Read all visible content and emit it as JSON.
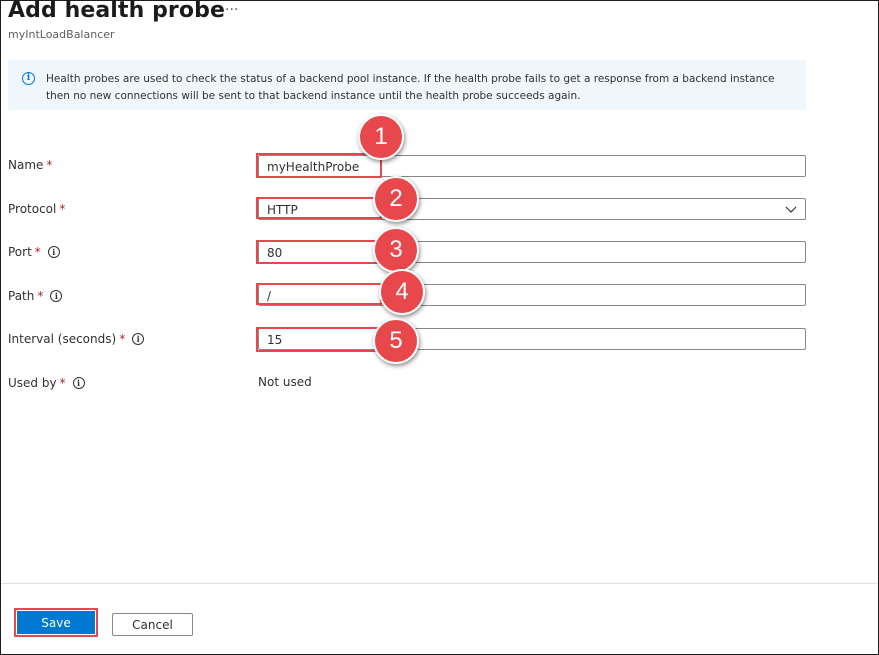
{
  "header": {
    "title": "Add health probe",
    "more_glyph": "···",
    "subtitle": "myIntLoadBalancer"
  },
  "info": {
    "icon": "info-icon",
    "text": "Health probes are used to check the status of a backend pool instance. If the health probe fails to get a response from a backend instance then no new connections will be sent to that backend instance until the health probe succeeds again."
  },
  "form": {
    "name": {
      "label": "Name",
      "value": "myHealthProbe"
    },
    "protocol": {
      "label": "Protocol",
      "value": "HTTP"
    },
    "port": {
      "label": "Port",
      "value": "80"
    },
    "path": {
      "label": "Path",
      "value": "/"
    },
    "interval": {
      "label": "Interval (seconds)",
      "value": "15"
    },
    "used_by": {
      "label": "Used by",
      "value": "Not used"
    },
    "required_mark": "*"
  },
  "annotations": [
    "1",
    "2",
    "3",
    "4",
    "5"
  ],
  "footer": {
    "save_label": "Save",
    "cancel_label": "Cancel"
  },
  "colors": {
    "accent": "#0078d4",
    "annotation": "#e8474b",
    "required": "#a4262c"
  }
}
